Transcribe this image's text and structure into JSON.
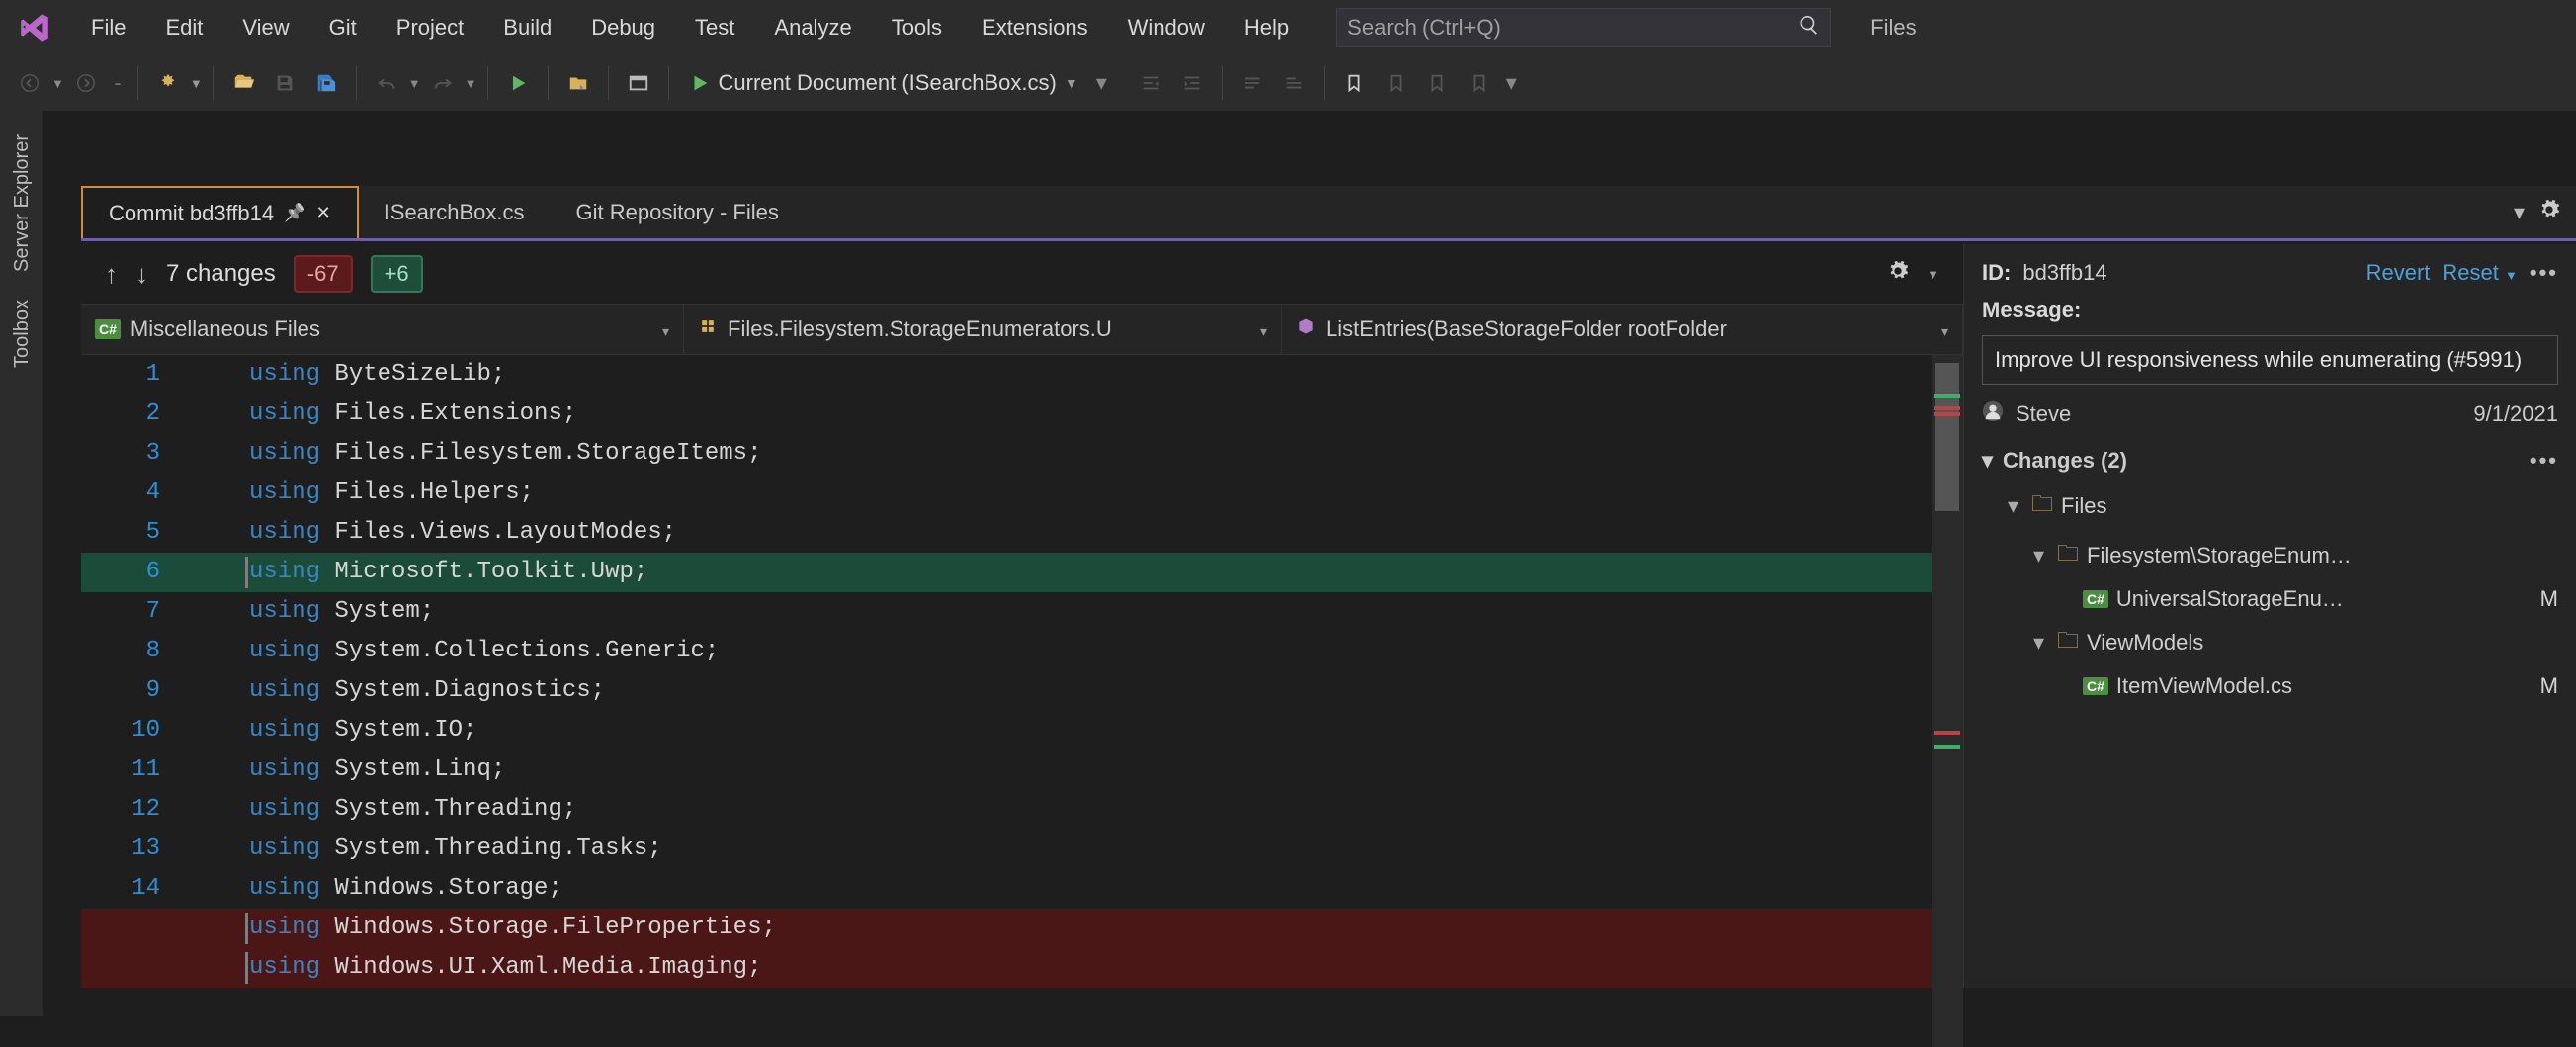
{
  "menubar": {
    "items": [
      "File",
      "Edit",
      "View",
      "Git",
      "Project",
      "Build",
      "Debug",
      "Test",
      "Analyze",
      "Tools",
      "Extensions",
      "Window",
      "Help"
    ],
    "search_placeholder": "Search (Ctrl+Q)",
    "trailing_label": "Files"
  },
  "toolbar": {
    "current_doc_label": "Current Document (ISearchBox.cs)"
  },
  "left_strip": {
    "tabs": [
      "Server Explorer",
      "Toolbox"
    ]
  },
  "doc_tabs": [
    {
      "label": "Commit bd3ffb14",
      "active": true,
      "pinned": true,
      "closable": true
    },
    {
      "label": "ISearchBox.cs",
      "active": false
    },
    {
      "label": "Git Repository - Files",
      "active": false
    }
  ],
  "diff": {
    "changes_label": "7 changes",
    "deletions": "-67",
    "additions": "+6",
    "crumbs": [
      {
        "icon": "cs",
        "label": "Miscellaneous Files"
      },
      {
        "icon": "ns",
        "label": "Files.Filesystem.StorageEnumerators.U"
      },
      {
        "icon": "method",
        "label": "ListEntries(BaseStorageFolder rootFolder"
      }
    ],
    "lines": [
      {
        "n": "1",
        "kw": "using",
        "rest": " ByteSizeLib;",
        "cls": ""
      },
      {
        "n": "2",
        "kw": "using",
        "rest": " Files.Extensions;",
        "cls": ""
      },
      {
        "n": "3",
        "kw": "using",
        "rest": " Files.Filesystem.StorageItems;",
        "cls": ""
      },
      {
        "n": "4",
        "kw": "using",
        "rest": " Files.Helpers;",
        "cls": ""
      },
      {
        "n": "5",
        "kw": "using",
        "rest": " Files.Views.LayoutModes;",
        "cls": ""
      },
      {
        "n": "6",
        "kw": "using",
        "rest": " Microsoft.Toolkit.Uwp;",
        "cls": "hl-add"
      },
      {
        "n": "7",
        "kw": "using",
        "rest": " System;",
        "cls": ""
      },
      {
        "n": "8",
        "kw": "using",
        "rest": " System.Collections.Generic;",
        "cls": ""
      },
      {
        "n": "9",
        "kw": "using",
        "rest": " System.Diagnostics;",
        "cls": ""
      },
      {
        "n": "10",
        "kw": "using",
        "rest": " System.IO;",
        "cls": ""
      },
      {
        "n": "11",
        "kw": "using",
        "rest": " System.Linq;",
        "cls": ""
      },
      {
        "n": "12",
        "kw": "using",
        "rest": " System.Threading;",
        "cls": ""
      },
      {
        "n": "13",
        "kw": "using",
        "rest": " System.Threading.Tasks;",
        "cls": ""
      },
      {
        "n": "14",
        "kw": "using",
        "rest": " Windows.Storage;",
        "cls": ""
      },
      {
        "n": "",
        "kw": "using",
        "rest": " Windows.Storage.FileProperties;",
        "cls": "hl-del"
      },
      {
        "n": "",
        "kw": "using",
        "rest": " Windows.UI.Xaml.Media.Imaging;",
        "cls": "hl-del"
      }
    ]
  },
  "detail": {
    "id_label": "ID:",
    "id": "bd3ffb14",
    "revert": "Revert",
    "reset": "Reset",
    "msg_label": "Message:",
    "msg": "Improve UI responsiveness while enumerating (#5991)",
    "author": "Steve",
    "date": "9/1/2021",
    "changes_header": "Changes (2)",
    "tree": [
      {
        "type": "folder",
        "label": "Files",
        "indent": 1,
        "expand": "▾"
      },
      {
        "type": "folder",
        "label": "Filesystem\\StorageEnum…",
        "indent": 2,
        "expand": "▾"
      },
      {
        "type": "file",
        "label": "UniversalStorageEnu…",
        "indent": 3,
        "mod": "M"
      },
      {
        "type": "folder",
        "label": "ViewModels",
        "indent": 2,
        "expand": "▾"
      },
      {
        "type": "file",
        "label": "ItemViewModel.cs",
        "indent": 3,
        "mod": "M"
      }
    ]
  }
}
